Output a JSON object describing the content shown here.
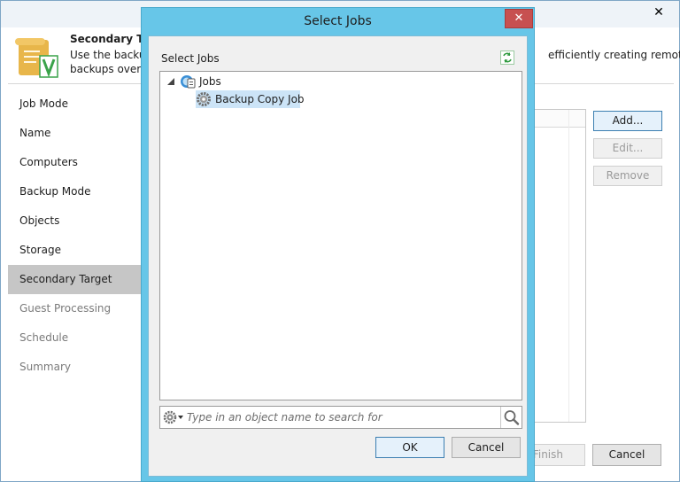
{
  "wizard": {
    "close_glyph": "✕",
    "header_title": "Secondary Target",
    "header_desc_left": "Use the backup copy jobs for efficiently creating remote",
    "header_desc_left_line2": "backups over WAN",
    "header_desc_right": "efficiently creating remote",
    "steps": [
      {
        "label": "Job Mode"
      },
      {
        "label": "Name"
      },
      {
        "label": "Computers"
      },
      {
        "label": "Backup Mode"
      },
      {
        "label": "Objects"
      },
      {
        "label": "Storage"
      },
      {
        "label": "Secondary Target"
      },
      {
        "label": "Guest Processing"
      },
      {
        "label": "Schedule"
      },
      {
        "label": "Summary"
      }
    ],
    "add_button": "Add...",
    "edit_button": "Edit...",
    "remove_button": "Remove",
    "finish_button": "Finish",
    "cancel_button": "Cancel"
  },
  "dialog": {
    "title": "Select Jobs",
    "close_glyph": "✕",
    "label": "Select Jobs",
    "tree": {
      "root_label": "Jobs",
      "child_label": "Backup Copy Job"
    },
    "search": {
      "placeholder": "Type in an object name to search for",
      "value": ""
    },
    "ok_button": "OK",
    "cancel_button": "Cancel"
  },
  "colors": {
    "dialog_frame": "#67c6e8",
    "selection": "#cce4f7",
    "active_step": "#c6c6c6",
    "close_red": "#c75050"
  }
}
